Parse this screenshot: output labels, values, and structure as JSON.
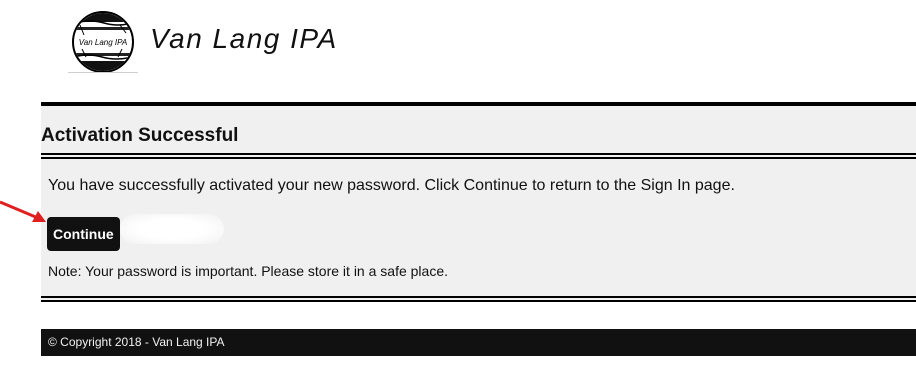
{
  "header": {
    "logo_text": "Van Lang IPA",
    "brand_title": "Van Lang IPA"
  },
  "main": {
    "title": "Activation Successful",
    "message": "You have successfully activated your new password. Click Continue to return to the Sign In page.",
    "continue_label": "Continue",
    "note": "Note: Your password is important. Please store it in a safe place."
  },
  "footer": {
    "copyright": "© Copyright 2018 - Van Lang IPA"
  },
  "colors": {
    "button_bg": "#111111",
    "content_bg": "#f0f0f0",
    "footer_bg": "#111111",
    "arrow": "#e02020"
  },
  "icons": {
    "logo": "bamboo-circle-logo",
    "annotation": "red-arrow-icon"
  }
}
